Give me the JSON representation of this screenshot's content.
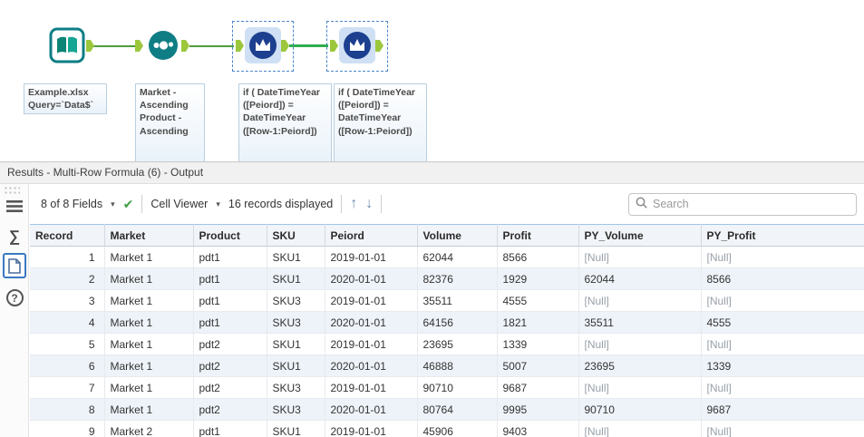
{
  "canvas": {
    "tools": [
      {
        "name": "input-data",
        "annotation": "Example.xlsx\nQuery=`Data$`"
      },
      {
        "name": "sort",
        "annotation": "Market -\nAscending\nProduct -\nAscending"
      },
      {
        "name": "multi-row-formula-5",
        "annotation": "if ( DateTimeYear\n([Peiord]) =\nDateTimeYear\n([Row-1:Peiord])"
      },
      {
        "name": "multi-row-formula-6",
        "annotation": "if ( DateTimeYear\n([Peiord]) =\nDateTimeYear\n([Row-1:Peiord])"
      }
    ]
  },
  "results": {
    "title": "Results - Multi-Row Formula (6) - Output",
    "toolbar": {
      "fields_dropdown": "8 of 8 Fields",
      "cell_viewer_dropdown": "Cell Viewer",
      "records_text": "16 records displayed",
      "search_placeholder": "Search"
    },
    "icons": {
      "check": "✔",
      "caret": "▾",
      "up_arrow": "↑",
      "down_arrow": "↓",
      "sigma": "∑",
      "question": "?"
    },
    "table": {
      "columns": [
        "Record",
        "Market",
        "Product",
        "SKU",
        "Peiord",
        "Volume",
        "Profit",
        "PY_Volume",
        "PY_Profit"
      ],
      "null_token": "[Null]",
      "rows": [
        [
          "1",
          "Market 1",
          "pdt1",
          "SKU1",
          "2019-01-01",
          "62044",
          "8566",
          "[Null]",
          "[Null]"
        ],
        [
          "2",
          "Market 1",
          "pdt1",
          "SKU1",
          "2020-01-01",
          "82376",
          "1929",
          "62044",
          "8566"
        ],
        [
          "3",
          "Market 1",
          "pdt1",
          "SKU3",
          "2019-01-01",
          "35511",
          "4555",
          "[Null]",
          "[Null]"
        ],
        [
          "4",
          "Market 1",
          "pdt1",
          "SKU3",
          "2020-01-01",
          "64156",
          "1821",
          "35511",
          "4555"
        ],
        [
          "5",
          "Market 1",
          "pdt2",
          "SKU1",
          "2019-01-01",
          "23695",
          "1339",
          "[Null]",
          "[Null]"
        ],
        [
          "6",
          "Market 1",
          "pdt2",
          "SKU1",
          "2020-01-01",
          "46888",
          "5007",
          "23695",
          "1339"
        ],
        [
          "7",
          "Market 1",
          "pdt2",
          "SKU3",
          "2019-01-01",
          "90710",
          "9687",
          "[Null]",
          "[Null]"
        ],
        [
          "8",
          "Market 1",
          "pdt2",
          "SKU3",
          "2020-01-01",
          "80764",
          "9995",
          "90710",
          "9687"
        ],
        [
          "9",
          "Market 2",
          "pdt1",
          "SKU1",
          "2019-01-01",
          "45906",
          "9403",
          "[Null]",
          "[Null]"
        ]
      ]
    }
  },
  "colors": {
    "teal": "#0e7e84",
    "tool_blue": "#1d3f8f",
    "anchor_green": "#9cc73c",
    "connector_green": "#4f9d3c",
    "selection_blue": "#3b78c3",
    "row_alt": "#eef3f9",
    "null_gray": "#98a0a8"
  }
}
